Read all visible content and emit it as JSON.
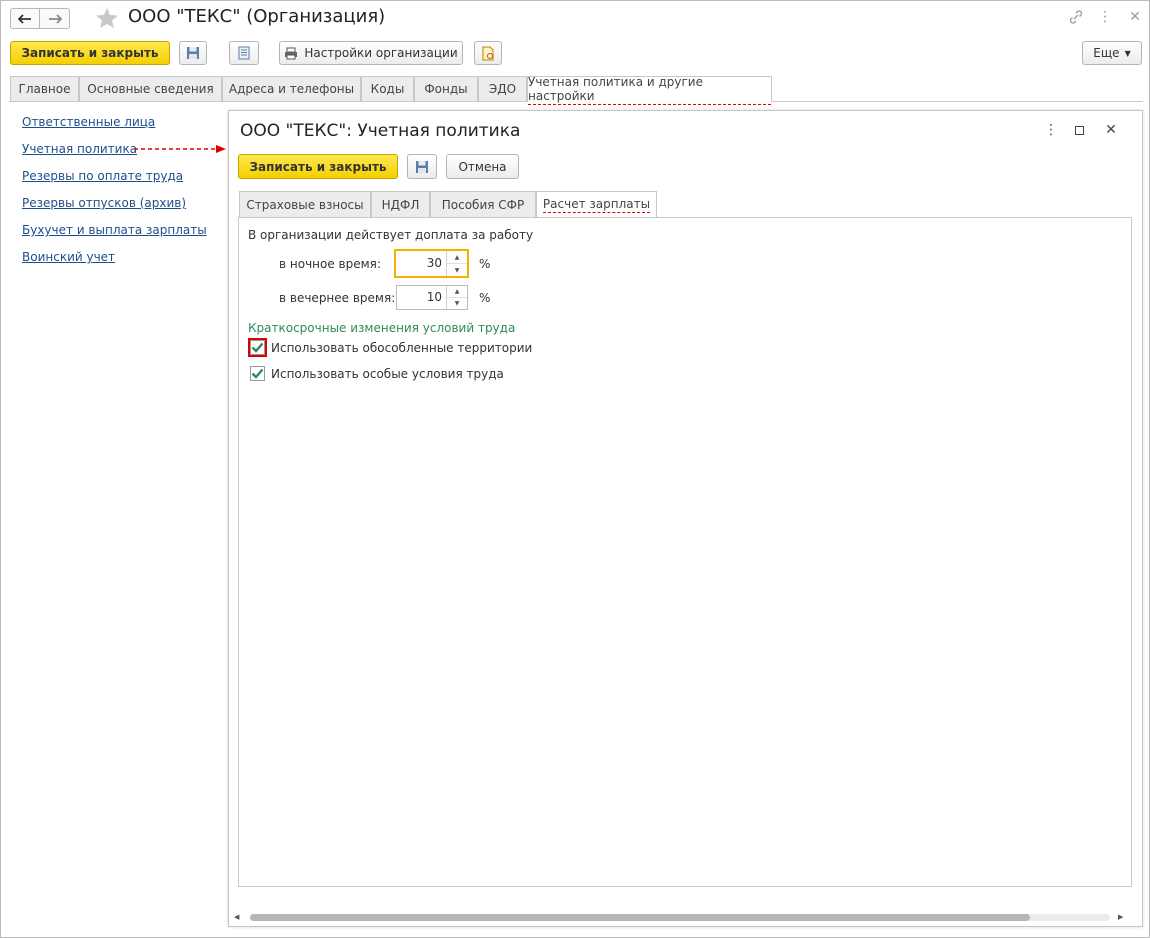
{
  "window": {
    "title": "ООО \"ТЕКС\" (Организация)",
    "icons": [
      "arrow-left-icon",
      "arrow-right-icon",
      "star-icon",
      "link-icon",
      "more-vertical-icon",
      "close-icon"
    ]
  },
  "toolbar": {
    "save_close": "Записать и закрыть",
    "org_settings": "Настройки организации",
    "more": "Еще"
  },
  "tabs": [
    {
      "label": "Главное"
    },
    {
      "label": "Основные сведения"
    },
    {
      "label": "Адреса и телефоны"
    },
    {
      "label": "Коды"
    },
    {
      "label": "Фонды"
    },
    {
      "label": "ЭДО"
    },
    {
      "label": "Учетная политика и другие настройки",
      "active": true
    }
  ],
  "sidebar": {
    "links": [
      {
        "label": "Ответственные лица"
      },
      {
        "label": "Учетная политика"
      },
      {
        "label": "Резервы по оплате труда"
      },
      {
        "label": "Резервы отпусков (архив)"
      },
      {
        "label": "Бухучет и выплата зарплаты"
      },
      {
        "label": "Воинский учет"
      }
    ]
  },
  "dialog": {
    "title": "ООО \"ТЕКС\": Учетная политика",
    "save_close": "Записать и закрыть",
    "cancel": "Отмена",
    "tabs": [
      {
        "label": "Страховые взносы"
      },
      {
        "label": "НДФЛ"
      },
      {
        "label": "Пособия СФР"
      },
      {
        "label": "Расчет зарплаты",
        "active": true
      }
    ],
    "content": {
      "section_title": "В организации действует доплата за работу",
      "night_label": "в ночное время:",
      "night_value": "30",
      "evening_label": "в вечернее время:",
      "evening_value": "10",
      "unit": "%",
      "group_title": "Краткосрочные изменения условий труда",
      "checkbox1": {
        "label": "Использовать обособленные территории",
        "checked": true
      },
      "checkbox2": {
        "label": "Использовать особые условия труда",
        "checked": true
      }
    }
  },
  "colors": {
    "primary_button": "#f4cf00",
    "link": "#1f4e8c",
    "group_title": "#2e8b57",
    "check": "#2e8b57",
    "annotation": "#e00000",
    "focus": "#f0b400"
  }
}
